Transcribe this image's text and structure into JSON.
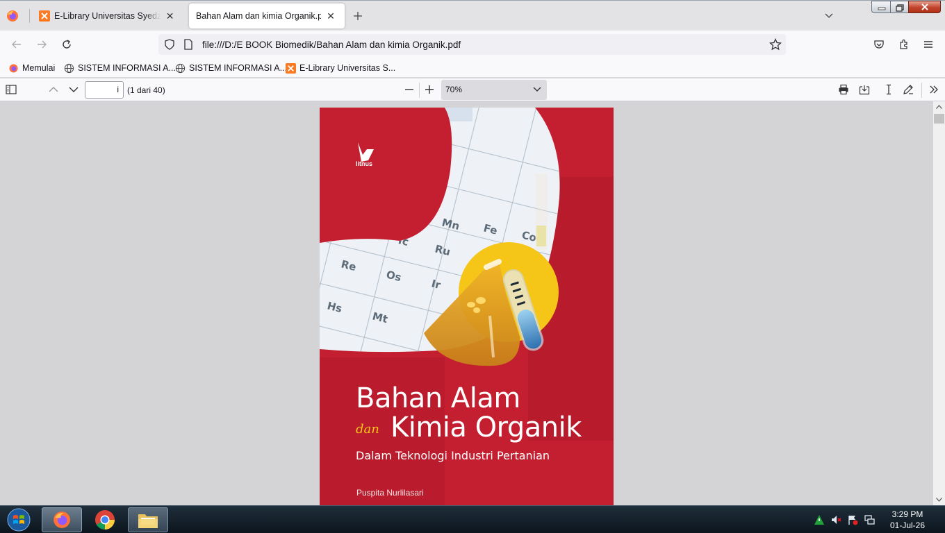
{
  "browser": {
    "tabs": [
      {
        "label": "E-Library Universitas Syedza Saintika",
        "icon": "xampp-favicon-icon",
        "active": false
      },
      {
        "label": "Bahan Alam dan kimia Organik.pdf",
        "icon": "",
        "active": true
      }
    ],
    "url": "file:///D:/E BOOK Biomedik/Bahan Alam dan kimia Organik.pdf",
    "bookmarks": [
      {
        "label": "Memulai",
        "icon": "firefox-icon"
      },
      {
        "label": "SISTEM INFORMASI A...",
        "icon": "globe-icon"
      },
      {
        "label": "SISTEM INFORMASI A...",
        "icon": "globe-icon"
      },
      {
        "label": "E-Library Universitas S...",
        "icon": "xampp-favicon-icon"
      }
    ]
  },
  "pdf_toolbar": {
    "page_value": "i",
    "page_count": "(1 dari 40)",
    "zoom": "70%"
  },
  "cover": {
    "publisher": "litnus",
    "title_line1": "Bahan Alam",
    "connector": "dan",
    "title_line2": "Kimia Organik",
    "subtitle": "Dalam Teknologi Industri Pertanian",
    "author": "Puspita Nurlilasari",
    "periodic_elements": [
      "Mn",
      "Fe",
      "Co",
      "Tc",
      "Ru",
      "Re",
      "Os",
      "Ir",
      "Hs",
      "Mt"
    ],
    "colors": {
      "background": "#c41f30",
      "accent": "#f5c518"
    }
  },
  "taskbar": {
    "time": "3:29 PM",
    "date": "01-Jul-26"
  }
}
